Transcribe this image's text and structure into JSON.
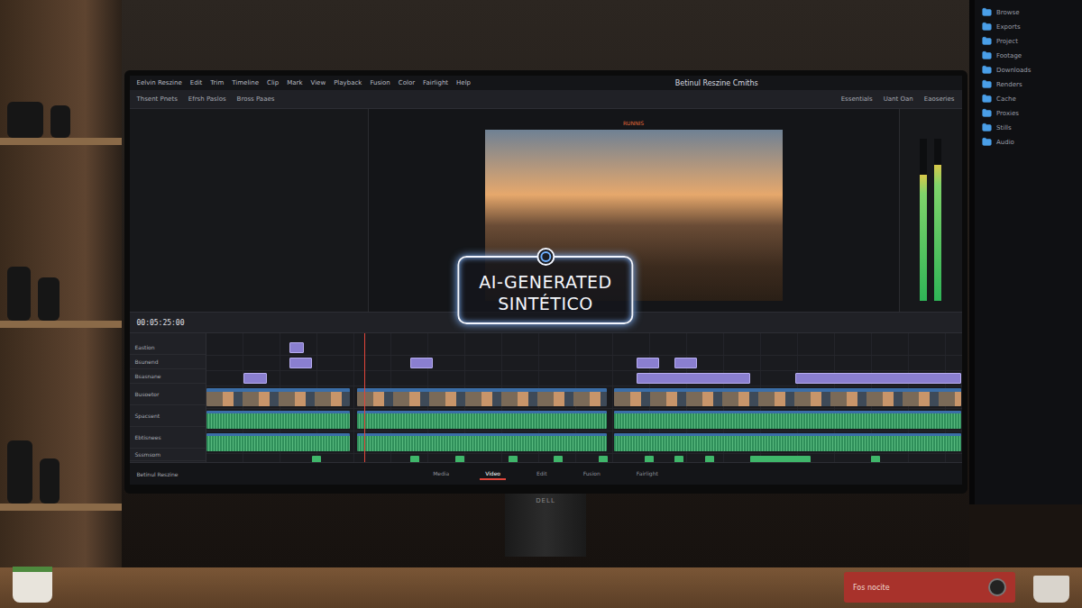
{
  "app": {
    "title": "Betinul Reszine",
    "subtitle": "Cmiths",
    "menu": [
      "Eelvin Reszine",
      "Edit",
      "Trim",
      "Timeline",
      "Clip",
      "Mark",
      "View",
      "Playback",
      "Fusion",
      "Color",
      "Fairlight",
      "Help"
    ]
  },
  "toolbar": {
    "left": [
      "Thsent Pnets",
      "Efrsh Paslos",
      "Bross Paaes"
    ],
    "right": [
      "Essentials",
      "Uant Oan",
      "Eaoseries"
    ]
  },
  "viewer": {
    "label": "RUNNIS"
  },
  "meters": [
    {
      "level": 0.78
    },
    {
      "level": 0.84
    }
  ],
  "timecode": "00:05:25:00",
  "tracks": [
    {
      "name": "Eastion",
      "kind": "title"
    },
    {
      "name": "Bsunend",
      "kind": "title"
    },
    {
      "name": "Bsasnane",
      "kind": "title"
    },
    {
      "name": "Busoetor",
      "kind": "video"
    },
    {
      "name": "Spacsent",
      "kind": "audio"
    },
    {
      "name": "Ebtisnees",
      "kind": "audio"
    },
    {
      "name": "Sssmsom",
      "kind": "marker"
    }
  ],
  "badge": {
    "line1": "AI-GENERATED",
    "line2": "SINTÉTICO"
  },
  "page_tabs": [
    {
      "label": "Media",
      "selected": false
    },
    {
      "label": "Video",
      "selected": true
    },
    {
      "label": "Edit",
      "selected": false
    },
    {
      "label": "Fusion",
      "selected": false
    },
    {
      "label": "Fairlight",
      "selected": false
    }
  ],
  "status": {
    "left": "Betinul Reszine"
  },
  "monitor": {
    "brand": "DELL"
  },
  "side_panel": {
    "items": [
      "Browse",
      "Exports",
      "Project",
      "Footage",
      "Downloads",
      "Renders",
      "Cache",
      "Proxies",
      "Stills",
      "Audio"
    ]
  },
  "interface": {
    "brand": "Fos nocite"
  }
}
